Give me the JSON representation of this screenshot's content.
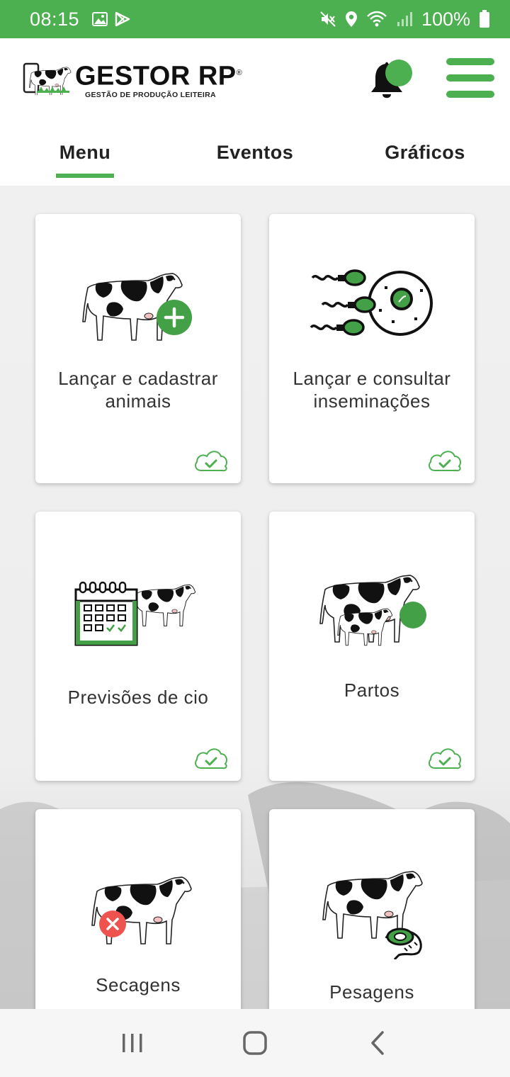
{
  "status_bar": {
    "time": "08:15",
    "battery_text": "100%",
    "icons": [
      "image-icon",
      "play-store-icon",
      "mute-icon",
      "location-icon",
      "wifi-icon",
      "signal-icon",
      "battery-icon"
    ]
  },
  "header": {
    "logo_title": "GESTOR RP",
    "logo_reg": "®",
    "logo_subtitle": "GESTÃO DE PRODUÇÃO LEITEIRA",
    "notification_icon": "bell-icon",
    "menu_icon": "hamburger-menu-icon"
  },
  "tabs": [
    {
      "label": "Menu",
      "active": true
    },
    {
      "label": "Eventos",
      "active": false
    },
    {
      "label": "Gráficos",
      "active": false
    }
  ],
  "cards": [
    {
      "label": "Lançar e cadastrar animais",
      "icon": "cow-add-icon",
      "synced": true
    },
    {
      "label": "Lançar e consultar inseminações",
      "icon": "insemination-icon",
      "synced": true
    },
    {
      "label": "Previsões de cio",
      "icon": "heat-calendar-icon",
      "synced": true
    },
    {
      "label": "Partos",
      "icon": "calving-icon",
      "synced": true
    },
    {
      "label": "Secagens",
      "icon": "drying-off-icon",
      "synced": false
    },
    {
      "label": "Pesagens",
      "icon": "weighing-icon",
      "synced": false
    }
  ],
  "colors": {
    "brand_green": "#4caf50",
    "error_red": "#ef5350",
    "card_bg": "#ffffff"
  },
  "nav_bar": {
    "buttons": [
      "recent-apps-icon",
      "home-icon",
      "back-icon"
    ]
  }
}
